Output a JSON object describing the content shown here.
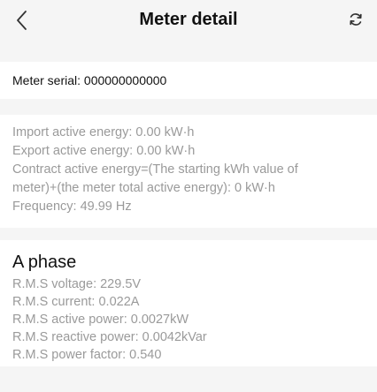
{
  "header": {
    "title": "Meter detail"
  },
  "serial": {
    "label": "Meter serial: 000000000000"
  },
  "energy": {
    "rows": [
      "Import active energy:  0.00 kW·h",
      "Export active energy:  0.00 kW·h",
      "Contract active energy=(The starting kWh value of",
      "meter)+(the meter total active energy):  0 kW·h",
      "Frequency:  49.99 Hz"
    ]
  },
  "phase": {
    "title": "A phase",
    "rows": [
      "R.M.S voltage:  229.5V",
      "R.M.S current:  0.022A",
      "R.M.S active power:  0.0027kW",
      "R.M.S reactive power:  0.0042kVar",
      "R.M.S power factor:  0.540"
    ]
  },
  "colors": {
    "background": "#f5f5f5",
    "card": "#ffffff",
    "text_primary": "#111111",
    "text_secondary": "#9a9a9a"
  },
  "icons": {
    "back": "chevron-left-icon",
    "refresh": "refresh-icon"
  }
}
